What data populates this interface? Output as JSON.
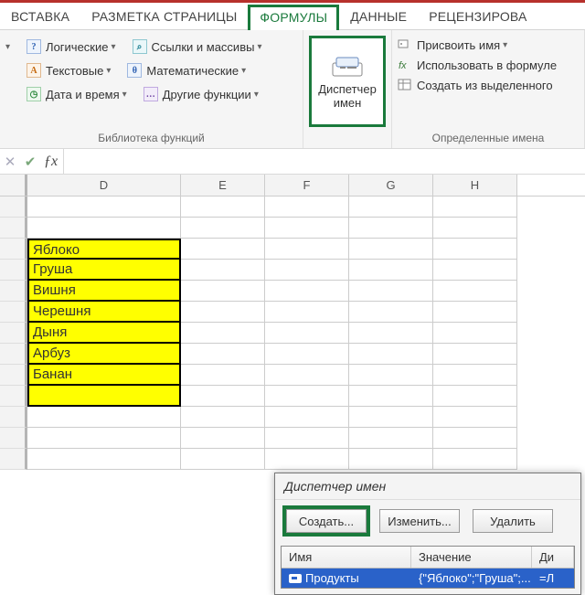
{
  "tabs": {
    "insert": "ВСТАВКА",
    "layout": "РАЗМЕТКА СТРАНИЦЫ",
    "formulas": "ФОРМУЛЫ",
    "data": "ДАННЫЕ",
    "review": "РЕЦЕНЗИРОВА"
  },
  "ribbon": {
    "lib": {
      "logical": "Логические",
      "text": "Текстовые",
      "datetime": "Дата и время",
      "lookup": "Ссылки и массивы",
      "math": "Математические",
      "more": "Другие функции",
      "title": "Библиотека функций"
    },
    "name_mgr": {
      "line1": "Диспетчер",
      "line2": "имен"
    },
    "names": {
      "define": "Присвоить имя",
      "use": "Использовать в формуле",
      "create": "Создать из выделенного",
      "title": "Определенные имена"
    }
  },
  "columns": {
    "D": "D",
    "E": "E",
    "F": "F",
    "G": "G",
    "H": "H"
  },
  "dataD": [
    "Яблоко",
    "Груша",
    "Вишня",
    "Черешня",
    "Дыня",
    "Арбуз",
    "Банан",
    ""
  ],
  "dialog": {
    "title": "Диспетчер имен",
    "create": "Создать...",
    "edit": "Изменить...",
    "delete": "Удалить",
    "colName": "Имя",
    "colValue": "Значение",
    "colD": "Ди",
    "rowName": "Продукты",
    "rowValue": "{\"Яблоко\";\"Груша\";...",
    "rowRef": "=Л"
  }
}
